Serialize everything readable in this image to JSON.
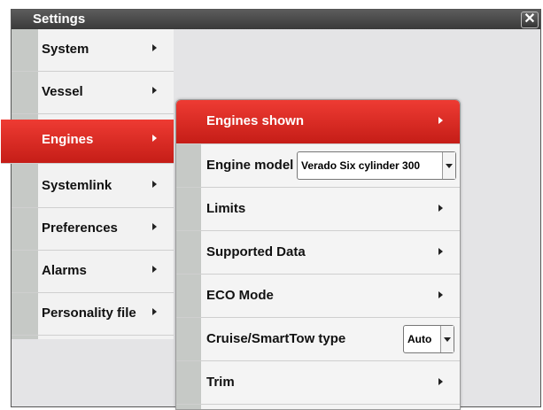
{
  "window": {
    "title": "Settings",
    "close_icon": "close-icon"
  },
  "left_menu": {
    "items": [
      {
        "label": "System",
        "selected": false
      },
      {
        "label": "Vessel",
        "selected": false
      },
      {
        "label": "Engines",
        "selected": true
      },
      {
        "label": "Systemlink",
        "selected": false
      },
      {
        "label": "Preferences",
        "selected": false
      },
      {
        "label": "Alarms",
        "selected": false
      },
      {
        "label": "Personality file",
        "selected": false
      }
    ]
  },
  "submenu": {
    "items": [
      {
        "label": "Engines shown",
        "selected": true
      },
      {
        "label": "Engine model",
        "dropdown_value": "Verado Six cylinder 300"
      },
      {
        "label": "Limits"
      },
      {
        "label": "Supported Data"
      },
      {
        "label": "ECO Mode"
      },
      {
        "label": "Cruise/SmartTow type",
        "dropdown_value": "Auto"
      },
      {
        "label": "Trim"
      }
    ]
  },
  "colors": {
    "accent": "#d9261f",
    "gutter": "#c6c9c6",
    "titlebar": "#4a4a4a"
  }
}
